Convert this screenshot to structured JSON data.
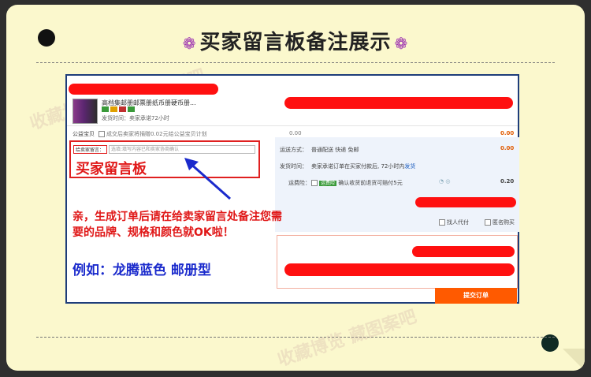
{
  "title": "买家留言板备注展示",
  "icons": {
    "flower": "flower-icon"
  },
  "product": {
    "name": "高档集邮册邮票册纸币册硬币册...",
    "shipping": "发货时间：卖家承诺72小时"
  },
  "charity": {
    "label": "公益宝贝",
    "text": "成交后卖家将捐赠0.02元给公益宝贝计划",
    "amount": "0.00",
    "total": "0.00"
  },
  "message": {
    "label": "给卖家留言：",
    "placeholder": "选填:填写内容已和卖家协商确认",
    "caption": "买家留言板"
  },
  "delivery": {
    "label": "运送方式：",
    "value": "普通配送 快递 免邮",
    "amount": "0.00"
  },
  "ship_time": {
    "label": "发货时间：",
    "text": "卖家承诺订单在买家付款后, 72小时内",
    "link": "发货"
  },
  "insurance": {
    "label": "运费险：",
    "badge": "运费险",
    "text": "确认收货前退货可赔付5元",
    "amount": "0.20"
  },
  "options": {
    "proxy": "找人代付",
    "anonymous": "匿名购买"
  },
  "submit_label": "提交订单",
  "notes": {
    "line1": "亲，生成订单后请在给卖家留言处备注您需要的品牌、规格和颜色就OK啦！",
    "example": "例如：龙腾蓝色 邮册型"
  },
  "watermarks": [
    "收藏博览",
    "藏图案吧",
    "收藏博览 藏图案吧"
  ],
  "colors": {
    "accent_red": "#e01818",
    "note_blue": "#1a2acc",
    "submit": "#ff5a00",
    "panel_border": "#1e3d7a"
  }
}
